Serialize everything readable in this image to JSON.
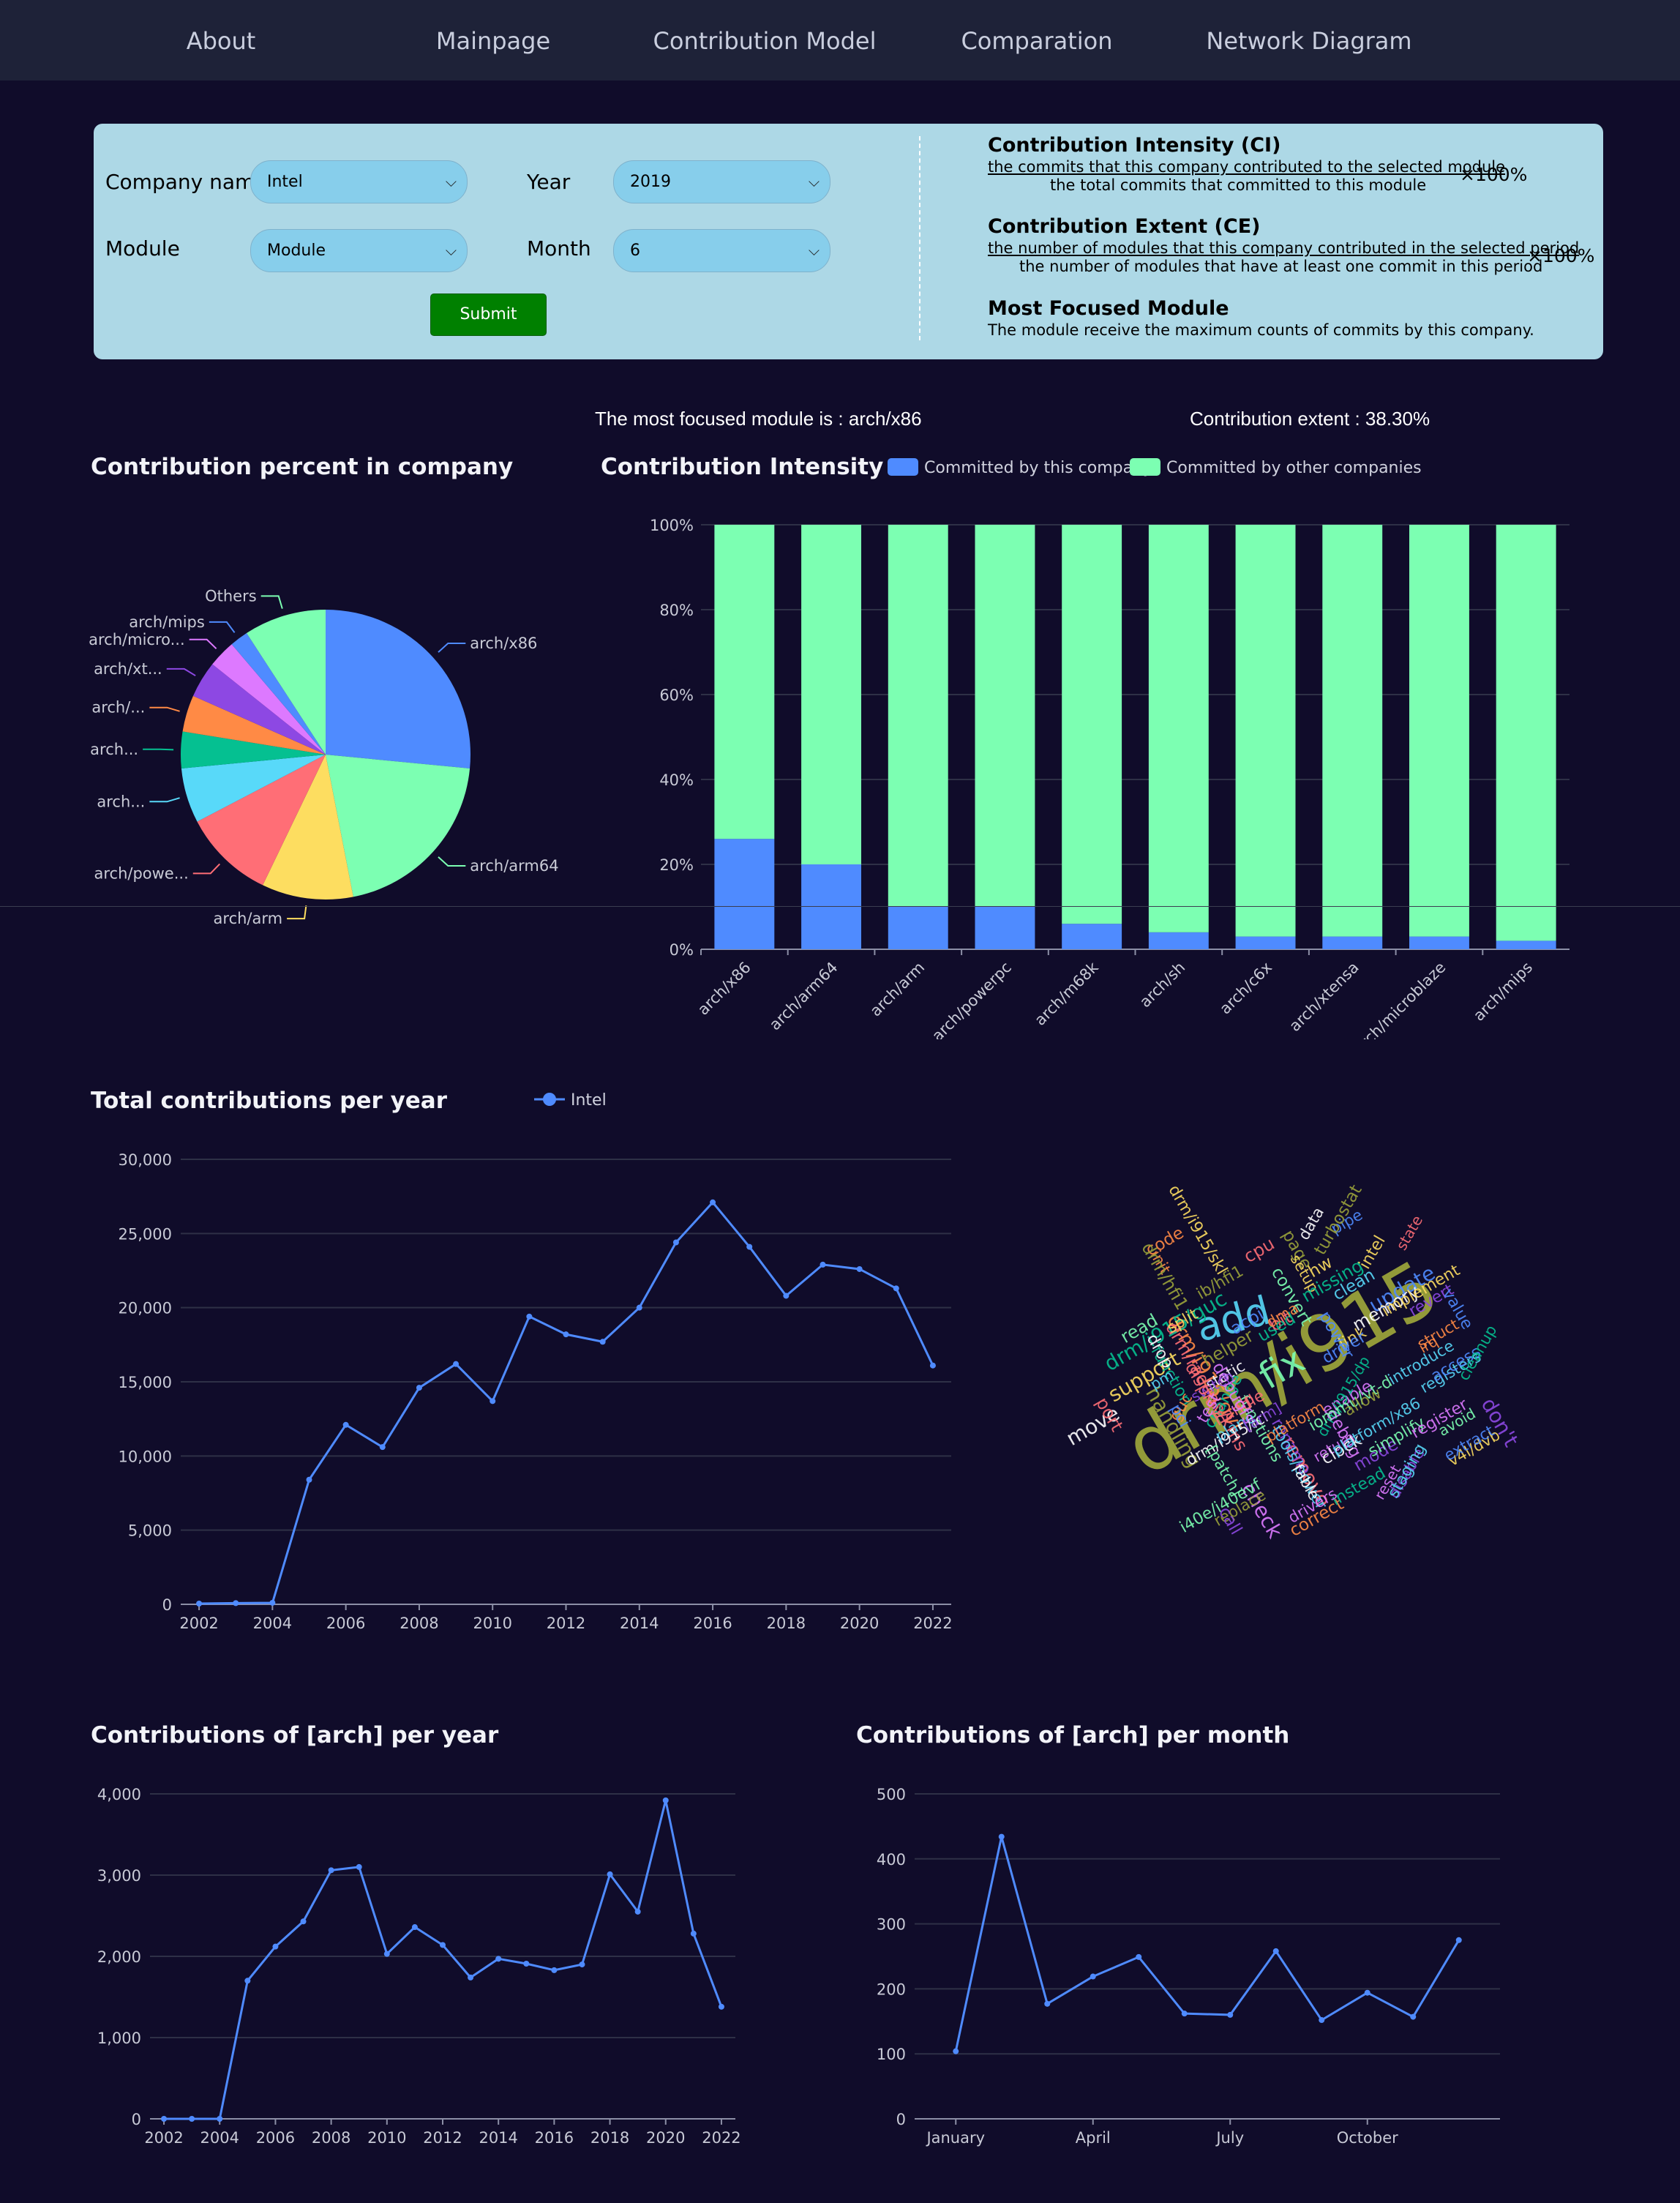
{
  "nav": {
    "items": [
      "About",
      "Mainpage",
      "Contribution Model",
      "Comparation",
      "Network Diagram"
    ]
  },
  "form": {
    "company_label": "Company name",
    "company_value": "Intel",
    "module_label": "Module",
    "module_value": "Module",
    "year_label": "Year",
    "year_value": "2019",
    "month_label": "Month",
    "month_value": "6",
    "submit_label": "Submit"
  },
  "definitions": {
    "ci_title": "Contribution Intensity (CI)",
    "ci_numerator": "the commits that this company contributed to the selected module",
    "ci_denominator": "the total commits that committed to this module",
    "ci_multiplier": "×100%",
    "ce_title": "Contribution Extent (CE)",
    "ce_numerator": "the number of modules that this company contributed in the selected period",
    "ce_denominator": "the number of modules that have at least one commit in this period",
    "ce_multiplier": "×100%",
    "mfm_title": "Most Focused Module",
    "mfm_description": "The module receive the maximum counts of commits by this company."
  },
  "stats": {
    "focused_module": "The most focused module is : arch/x86",
    "contribution_extent": "Contribution extent : 38.30%"
  },
  "chart_data": [
    {
      "id": "pie",
      "type": "pie",
      "title": "Contribution percent in company",
      "slices": [
        {
          "label": "arch/x86",
          "value": 26,
          "color": "#4f8bff"
        },
        {
          "label": "arch/arm64",
          "value": 20,
          "color": "#7cffb2"
        },
        {
          "label": "arch/arm",
          "value": 10,
          "color": "#fddd60"
        },
        {
          "label": "arch/powe...",
          "value": 10,
          "color": "#ff6e76"
        },
        {
          "label": "arch...",
          "value": 6,
          "color": "#58d9f9"
        },
        {
          "label": "arch...",
          "value": 4,
          "color": "#05c091"
        },
        {
          "label": "arch/...",
          "value": 4,
          "color": "#ff8a45"
        },
        {
          "label": "arch/xt...",
          "value": 4,
          "color": "#8d48e3"
        },
        {
          "label": "arch/micro...",
          "value": 3,
          "color": "#dd79ff"
        },
        {
          "label": "arch/mips",
          "value": 2,
          "color": "#4f8bff"
        },
        {
          "label": "Others",
          "value": 9,
          "color": "#7cffb2"
        }
      ]
    },
    {
      "id": "ci",
      "type": "bar",
      "title": "Contribution Intensity",
      "categories": [
        "arch/x86",
        "arch/arm64",
        "arch/arm",
        "arch/powerpc",
        "arch/m68k",
        "arch/sh",
        "arch/c6x",
        "arch/xtensa",
        "arch/microblaze",
        "arch/mips"
      ],
      "series": [
        {
          "name": "Committed by this company",
          "color": "#4f8bff",
          "values": [
            26,
            20,
            10,
            10,
            6,
            4,
            3,
            3,
            3,
            2
          ]
        },
        {
          "name": "Committed by other companies",
          "color": "#7cffb2",
          "values": [
            74,
            80,
            90,
            90,
            94,
            96,
            97,
            97,
            97,
            98
          ]
        }
      ],
      "yticks": [
        "0%",
        "20%",
        "40%",
        "60%",
        "80%",
        "100%"
      ],
      "ylim": [
        0,
        100
      ],
      "stacked": true,
      "legend": "top"
    },
    {
      "id": "total",
      "type": "line",
      "title": "Total contributions per year",
      "series": [
        {
          "name": "Intel",
          "color": "#4f8bff"
        }
      ],
      "x": [
        2002,
        2003,
        2004,
        2005,
        2006,
        2007,
        2008,
        2009,
        2010,
        2011,
        2012,
        2013,
        2014,
        2015,
        2016,
        2017,
        2018,
        2019,
        2020,
        2021,
        2022
      ],
      "y": [
        50,
        80,
        100,
        8400,
        12100,
        10600,
        14600,
        16200,
        13700,
        19400,
        18200,
        17700,
        20000,
        24400,
        27100,
        24100,
        20800,
        22900,
        22600,
        21300,
        16100
      ],
      "xticks": [
        "2002",
        "2004",
        "2006",
        "2008",
        "2010",
        "2012",
        "2014",
        "2016",
        "2018",
        "2020",
        "2022"
      ],
      "yticks": [
        "0",
        "5,000",
        "10,000",
        "15,000",
        "20,000",
        "25,000",
        "30,000"
      ],
      "ylim": [
        0,
        30000
      ],
      "legend": "top"
    },
    {
      "id": "arch_year",
      "type": "line",
      "title": "Contributions of [arch] per year",
      "x": [
        2002,
        2003,
        2004,
        2005,
        2006,
        2007,
        2008,
        2009,
        2010,
        2011,
        2012,
        2013,
        2014,
        2015,
        2016,
        2017,
        2018,
        2019,
        2020,
        2021,
        2022
      ],
      "y": [
        0,
        0,
        0,
        1700,
        2120,
        2430,
        3060,
        3100,
        2030,
        2360,
        2140,
        1740,
        1970,
        1910,
        1830,
        1900,
        3010,
        2550,
        3920,
        2280,
        1380
      ],
      "xticks": [
        "2002",
        "2004",
        "2006",
        "2008",
        "2010",
        "2012",
        "2014",
        "2016",
        "2018",
        "2020",
        "2022"
      ],
      "yticks": [
        "0",
        "1,000",
        "2,000",
        "3,000",
        "4,000"
      ],
      "ylim": [
        0,
        4000
      ]
    },
    {
      "id": "arch_month",
      "type": "line",
      "title": "Contributions of [arch] per month",
      "x": [
        1,
        2,
        3,
        4,
        5,
        6,
        7,
        8,
        9,
        10,
        11,
        12
      ],
      "y": [
        104,
        434,
        177,
        219,
        249,
        162,
        160,
        258,
        152,
        194,
        157,
        275
      ],
      "xticks": [
        "January",
        "April",
        "July",
        "October"
      ],
      "yticks": [
        "0",
        "100",
        "200",
        "300",
        "400",
        "500"
      ],
      "ylim": [
        0,
        500
      ]
    }
  ],
  "wordcloud": {
    "words": [
      "drm/i915",
      "add",
      "fix",
      "support",
      "remove",
      "update",
      "check",
      "drm/i915/gvt",
      "drm/i915/guc",
      "don't",
      "move",
      "handling",
      "introduce",
      "functions",
      "v4l/dvb",
      "drm/radeon/kms",
      "acpi",
      "enable",
      "code",
      "function",
      "rename",
      "data",
      "page",
      "plane",
      "convert",
      "split",
      "port",
      "pipe",
      "reset",
      "correct",
      "drm/i915/dp",
      "mode",
      "static",
      "replace",
      "registers",
      "simplify",
      "setup",
      "cpu",
      "extract",
      "return",
      "guc",
      "change",
      "revert",
      "memory",
      "turbostat",
      "clean",
      "read",
      "hw",
      "bit",
      "access",
      "debug",
      "irq",
      "instead",
      "call",
      "clock",
      "helper",
      "tools/power",
      "avoid",
      "link",
      "dp",
      "power",
      "drivers",
      "init",
      "missing",
      "disable",
      "drm/i915/icl",
      "drm/hfi1",
      "staging",
      "[patch]",
      "intel",
      "handle",
      "value",
      "debugfs",
      "platform",
      "cleanup",
      "switch",
      "fable",
      "ib/hfi1",
      "pm",
      "iommu/vt-d",
      "drm/i915/skl",
      "state",
      "driver",
      "register",
      "struct",
      "used",
      "[arm]",
      "drop",
      "allow",
      "platform/x86",
      "i40e/i40evf",
      "implement",
      "display",
      "pci",
      "test",
      "dma"
    ],
    "colors": [
      "#9aa23a",
      "#58d9f9",
      "#7cffb2",
      "#fddd60",
      "#ff6e76",
      "#4f8bff",
      "#dd79ff",
      "#ff8a45",
      "#05c091",
      "#8d48e3",
      "#ffffff"
    ]
  }
}
